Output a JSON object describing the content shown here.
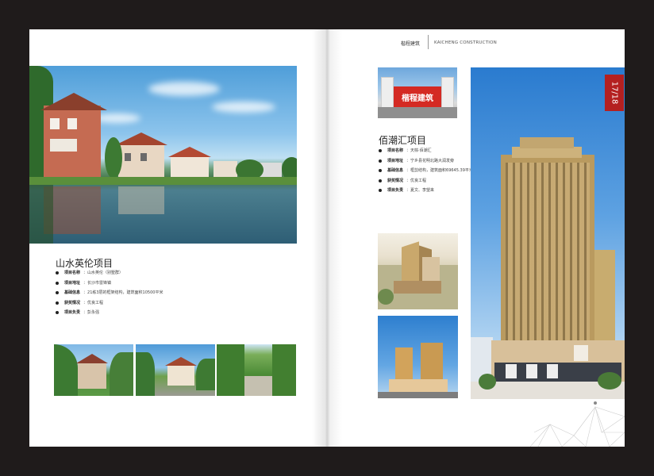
{
  "header": {
    "brand_cn": "楷程建筑",
    "brand_en": "KAICHENG CONSTRUCTION",
    "page_number": "17/18"
  },
  "left": {
    "title": "山水英伦项目",
    "rows": [
      {
        "label": "项目名称",
        "value": "：山水英伦（别墅群）"
      },
      {
        "label": "项目地址",
        "value": "：长沙市雷锋镇"
      },
      {
        "label": "基础信息",
        "value": "：21栋3层的框架结构，建筑面积10500平米"
      },
      {
        "label": "获奖情况",
        "value": "：优良工程"
      },
      {
        "label": "项目负责",
        "value": "：彭永强"
      }
    ]
  },
  "right": {
    "title": "佰潮汇项目",
    "rows": [
      {
        "label": "项目名称",
        "value": "：天棕·佰潮汇"
      },
      {
        "label": "项目地址",
        "value": "：宁乡县花明北路大润发旁"
      },
      {
        "label": "基础信息",
        "value": "：框剪结构，建筑面积69645.39平米"
      },
      {
        "label": "获奖情况",
        "value": "：优良工程"
      },
      {
        "label": "项目负责",
        "value": "：夏文、李望来"
      }
    ],
    "gate_sign": "楷程建筑"
  }
}
